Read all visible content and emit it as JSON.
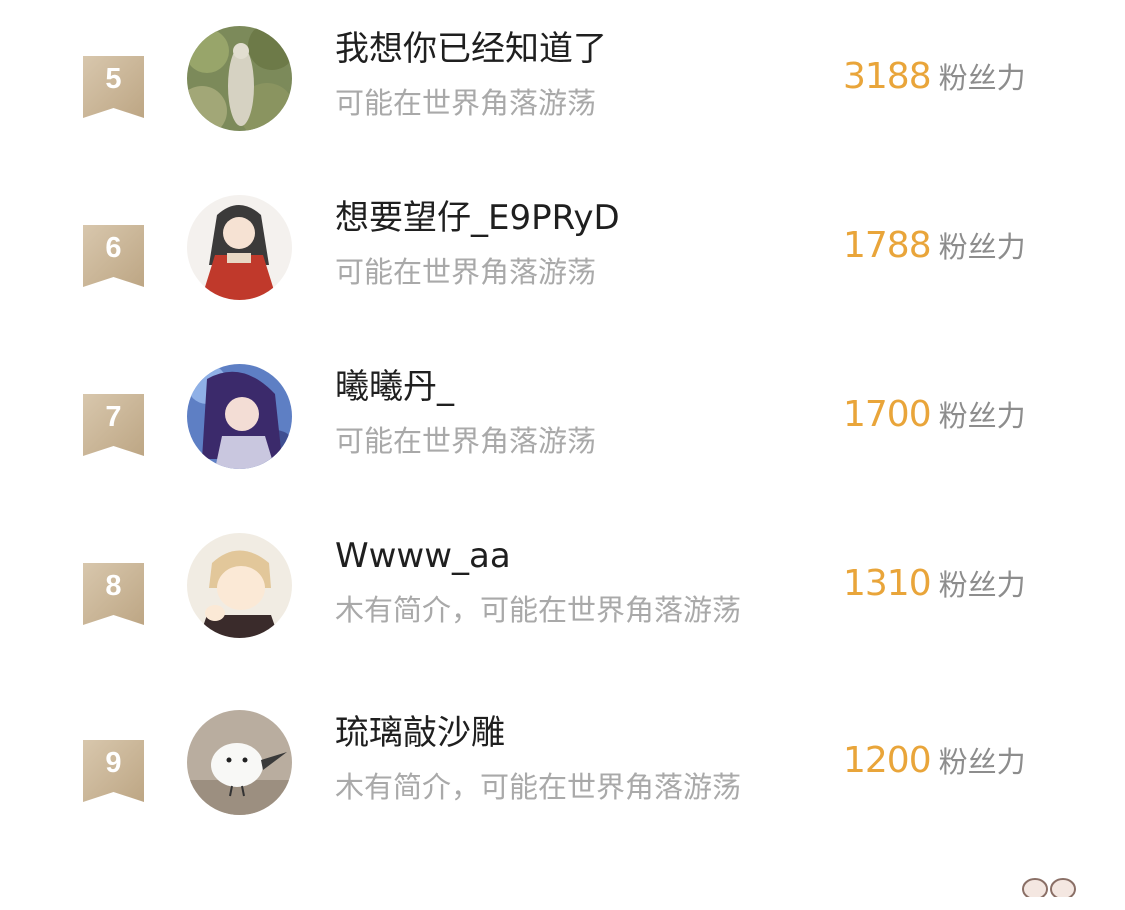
{
  "colors": {
    "accent": "#e9a53a",
    "ribbon": "#c9b59a",
    "name": "#1f1f1f",
    "bio": "#a9a9a9",
    "unit": "#8d8d8d"
  },
  "ranking": {
    "rows": [
      {
        "rank": "5",
        "name": "我想你已经知道了",
        "bio": "可能在世界角落游荡",
        "score": "3188",
        "unit": "粉丝力",
        "avatar_icon": "statue-garden-avatar-icon"
      },
      {
        "rank": "6",
        "name": "想要望仔_E9PRyD",
        "bio": "可能在世界角落游荡",
        "score": "1788",
        "unit": "粉丝力",
        "avatar_icon": "red-dress-girl-avatar-icon"
      },
      {
        "rank": "7",
        "name": "曦曦丹_",
        "bio": "可能在世界角落游荡",
        "score": "1700",
        "unit": "粉丝力",
        "avatar_icon": "anime-purple-hair-avatar-icon"
      },
      {
        "rank": "8",
        "name": "Wwww_aa",
        "bio": "木有简介，可能在世界角落游荡",
        "score": "1310",
        "unit": "粉丝力",
        "avatar_icon": "cartoon-boy-avatar-icon"
      },
      {
        "rank": "9",
        "name": "琉璃敲沙雕",
        "bio": "木有简介，可能在世界角落游荡",
        "score": "1200",
        "unit": "粉丝力",
        "avatar_icon": "white-bird-avatar-icon"
      }
    ]
  }
}
